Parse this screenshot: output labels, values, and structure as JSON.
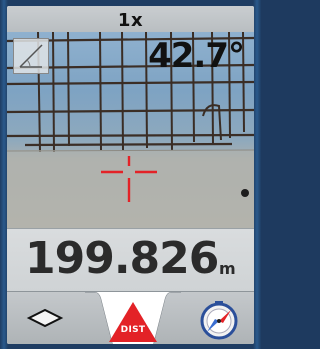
{
  "zoom": {
    "label": "1x"
  },
  "measurement": {
    "angle": "42.7°",
    "distance": "199.826",
    "unit": "m"
  },
  "toolbar": {
    "center_tab_label": "DIST"
  },
  "colors": {
    "crosshair": "#e32227",
    "dist_triangle": "#e32227",
    "compass_blue": "#3b6fd1"
  },
  "icons": {
    "tilt": "tilt-angle-icon",
    "area": "area-plane-icon",
    "compass": "compass-icon"
  }
}
